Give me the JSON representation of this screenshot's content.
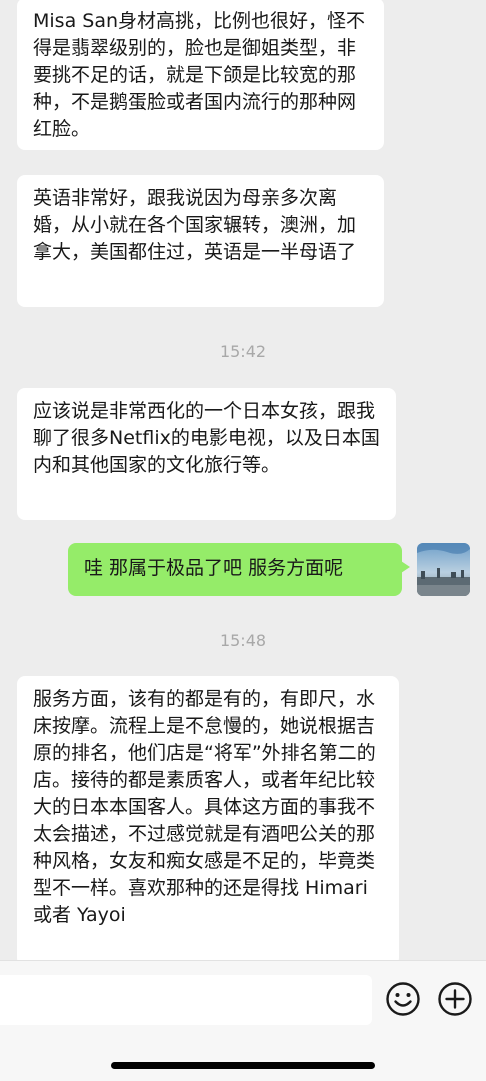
{
  "messages": [
    {
      "side": "left",
      "text": "Misa San身材高挑，比例也很好，怪不得是翡翠级别的，脸也是御姐类型，非要挑不足的话，就是下颌是比较宽的那种，不是鹅蛋脸或者国内流行的那种网红脸。"
    },
    {
      "side": "left",
      "text": "英语非常好，跟我说因为母亲多次离婚，从小就在各个国家辗转，澳洲，加拿大，美国都住过，英语是一半母语了"
    },
    {
      "time": "15:42"
    },
    {
      "side": "left",
      "text": "应该说是非常西化的一个日本女孩，跟我聊了很多Netflix的电影电视，以及日本国内和其他国家的文化旅行等。"
    },
    {
      "side": "right",
      "text": "哇 那属于极品了吧 服务方面呢"
    },
    {
      "time": "15:48"
    },
    {
      "side": "left",
      "text": "服务方面，该有的都是有的，有即尺，水床按摩。流程上是不怠慢的，她说根据吉原的排名，他们店是“将军”外排名第二的店。接待的都是素质客人，或者年纪比较大的日本本国客人。具体这方面的事我不太会描述，不过感觉就是有酒吧公关的那种风格，女友和痴女感是不足的，毕竟类型不一样。喜欢那种的还是得找 Himari或者 Yayoi"
    }
  ],
  "input_bar": {
    "value": ""
  },
  "icons": [
    "emoji-icon",
    "plus-icon"
  ],
  "colors": {
    "background": "#ededed",
    "bubble_left": "#ffffff",
    "bubble_right": "#95ec69",
    "time_text": "#a8a8a8"
  }
}
